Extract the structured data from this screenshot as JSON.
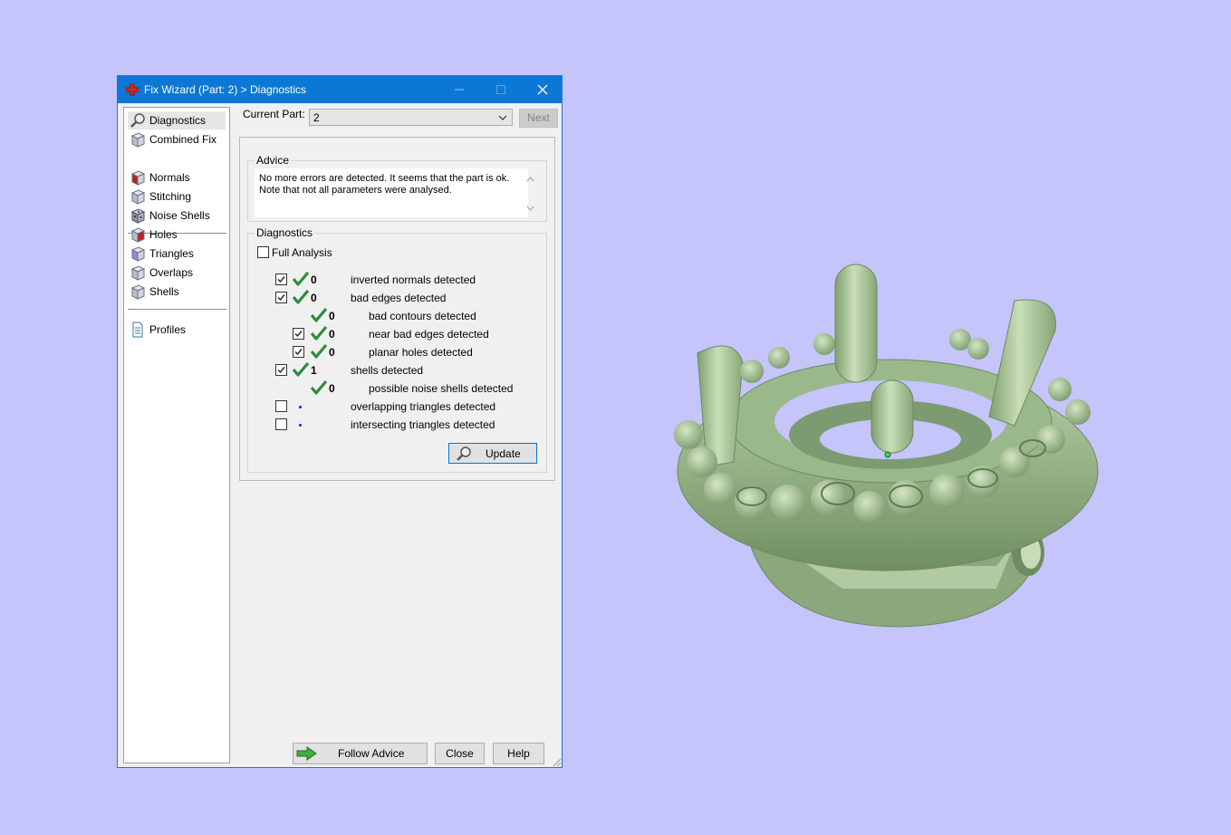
{
  "window": {
    "title": "Fix Wizard (Part: 2) > Diagnostics"
  },
  "nav": {
    "items": [
      {
        "label": "Diagnostics",
        "icon": "magnifier-icon"
      },
      {
        "label": "Combined Fix",
        "icon": "cube-icon"
      },
      {
        "label": "Normals",
        "icon": "cube-red-icon"
      },
      {
        "label": "Stitching",
        "icon": "cube-icon"
      },
      {
        "label": "Noise Shells",
        "icon": "dice-icon"
      },
      {
        "label": "Holes",
        "icon": "cube-red-icon"
      },
      {
        "label": "Triangles",
        "icon": "cube-purple-icon"
      },
      {
        "label": "Overlaps",
        "icon": "cube-icon"
      },
      {
        "label": "Shells",
        "icon": "cube-icon"
      },
      {
        "label": "Profiles",
        "icon": "document-icon"
      }
    ]
  },
  "current_part": {
    "label": "Current Part:",
    "value": "2",
    "next_label": "Next"
  },
  "advice": {
    "title": "Advice",
    "line1": "No more errors are detected. It seems that the part is ok.",
    "line2": "Note that not all parameters were analysed."
  },
  "diagnostics": {
    "title": "Diagnostics",
    "full_analysis_label": "Full Analysis",
    "full_analysis_checked": false,
    "rows": [
      {
        "checked": true,
        "status": "ok",
        "count": "0",
        "label": "inverted normals detected"
      },
      {
        "checked": true,
        "status": "ok",
        "count": "0",
        "label": "bad edges detected"
      },
      {
        "checked": null,
        "status": "ok",
        "count": "0",
        "label": "bad contours detected"
      },
      {
        "checked": true,
        "status": "ok",
        "count": "0",
        "label": "near bad edges detected"
      },
      {
        "checked": true,
        "status": "ok",
        "count": "0",
        "label": "planar holes detected"
      },
      {
        "checked": true,
        "status": "ok",
        "count": "1",
        "label": "shells detected"
      },
      {
        "checked": null,
        "status": "ok",
        "count": "0",
        "label": "possible noise shells detected"
      },
      {
        "checked": false,
        "status": "not-analysed",
        "count": "",
        "label": "overlapping triangles detected"
      },
      {
        "checked": false,
        "status": "not-analysed",
        "count": "",
        "label": "intersecting triangles detected"
      }
    ],
    "update_label": "Update"
  },
  "footer": {
    "follow_advice_label": "Follow Advice",
    "close_label": "Close",
    "help_label": "Help"
  },
  "colors": {
    "desktop": "#c5c4fb",
    "titlebar": "#0c78d6",
    "ok_check": "#2e8b3e",
    "model": "#a6c294"
  }
}
